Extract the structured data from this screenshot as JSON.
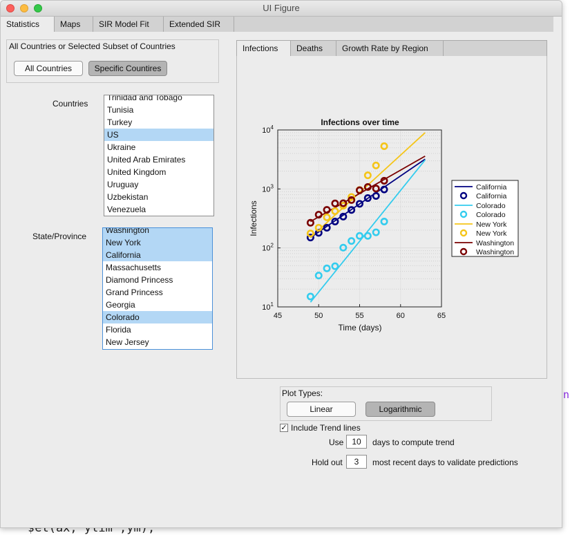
{
  "window": {
    "title": "UI Figure"
  },
  "main_tabs": [
    "Statistics",
    "Maps",
    "SIR Model Fit",
    "Extended SIR"
  ],
  "country_group": {
    "title": "All Countries or Selected Subset of Countries",
    "all_button": "All Countries",
    "specific_button": "Specific Countires"
  },
  "countries": {
    "label": "Countries",
    "items": [
      "Trinidad and Tobago",
      "Tunisia",
      "Turkey",
      "US",
      "Ukraine",
      "United Arab Emirates",
      "United Kingdom",
      "Uruguay",
      "Uzbekistan",
      "Venezuela"
    ],
    "selected": [
      "US"
    ]
  },
  "states": {
    "label": "State/Province",
    "items": [
      "Washington",
      "New York",
      "California",
      "Massachusetts",
      "Diamond Princess",
      "Grand Princess",
      "Georgia",
      "Colorado",
      "Florida",
      "New Jersey"
    ],
    "selected": [
      "Washington",
      "New York",
      "California",
      "Colorado"
    ]
  },
  "plot_tabs": [
    "Infections",
    "Deaths",
    "Growth Rate by Region"
  ],
  "chart_data": {
    "type": "scatter",
    "title": "Infections over time",
    "xlabel": "Time (days)",
    "ylabel": "Infections",
    "xlim": [
      45,
      65
    ],
    "ylim": [
      10,
      10000
    ],
    "yscale": "log",
    "xticks": [
      "45",
      "50",
      "55",
      "60",
      "65"
    ],
    "yticks": [
      "10^1",
      "10^2",
      "10^3",
      "10^4"
    ],
    "grid": true,
    "legend_position": "right-outside",
    "series": [
      {
        "name": "California",
        "color": "#000080",
        "x": [
          49,
          50,
          51,
          52,
          53,
          54,
          55,
          56,
          57,
          58
        ],
        "y": [
          150,
          180,
          220,
          280,
          340,
          440,
          560,
          700,
          760,
          980
        ],
        "trend": {
          "x": [
            49,
            63
          ],
          "y": [
            150,
            3200
          ]
        }
      },
      {
        "name": "Colorado",
        "color": "#33ccee",
        "x": [
          49,
          50,
          51,
          52,
          53,
          54,
          55,
          56,
          57,
          58
        ],
        "y": [
          15,
          34,
          45,
          49,
          101,
          131,
          160,
          160,
          184,
          280
        ],
        "trend": {
          "x": [
            49,
            63
          ],
          "y": [
            12,
            3100
          ]
        }
      },
      {
        "name": "New York",
        "color": "#f5c518",
        "x": [
          49,
          50,
          51,
          52,
          53,
          54,
          55,
          56,
          57,
          58
        ],
        "y": [
          176,
          220,
          330,
          420,
          520,
          730,
          960,
          1700,
          2500,
          5300
        ],
        "trend": {
          "x": [
            49,
            63
          ],
          "y": [
            150,
            9000
          ]
        }
      },
      {
        "name": "Washington",
        "color": "#7a0000",
        "x": [
          49,
          50,
          51,
          52,
          53,
          54,
          55,
          56,
          57,
          58
        ],
        "y": [
          267,
          366,
          442,
          568,
          572,
          648,
          948,
          1080,
          1015,
          1376
        ],
        "trend": {
          "x": [
            49,
            63
          ],
          "y": [
            280,
            3600
          ]
        }
      }
    ]
  },
  "plot_types": {
    "title": "Plot Types:",
    "linear": "Linear",
    "log": "Logarithmic"
  },
  "trend": {
    "include_label": "Include Trend lines",
    "checked": true,
    "use_label": "Use",
    "days_value": "10",
    "days_label": "days to compute trend",
    "holdout_label": "Hold out",
    "holdout_value": "3",
    "holdout_suffix": "most recent days to validate predictions"
  },
  "background": {
    "code": "set(ax,'ylim',ym);",
    "stray": "n"
  }
}
